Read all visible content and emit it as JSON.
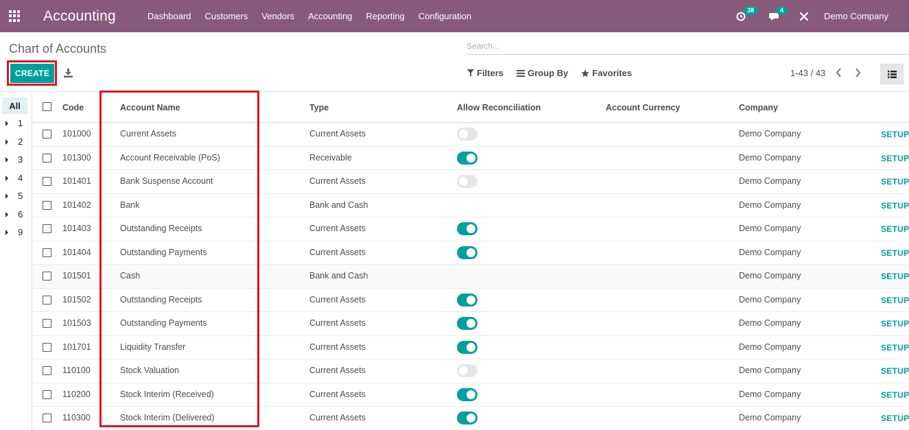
{
  "navbar": {
    "app_title": "Accounting",
    "menu": [
      "Dashboard",
      "Customers",
      "Vendors",
      "Accounting",
      "Reporting",
      "Configuration"
    ],
    "activity_count": "38",
    "message_count": "4",
    "company": "Demo Company",
    "icons": [
      "apps-grid-icon",
      "activity-clock-icon",
      "chat-bubble-icon",
      "tools-icon"
    ]
  },
  "control_panel": {
    "title": "Chart of Accounts",
    "search_placeholder": "Search...",
    "create_label": "CREATE",
    "filters_label": "Filters",
    "group_by_label": "Group By",
    "favorites_label": "Favorites",
    "pager": "1-43 / 43"
  },
  "side_panel": {
    "all_label": "All",
    "groups": [
      "1",
      "2",
      "3",
      "4",
      "5",
      "6",
      "9"
    ]
  },
  "table": {
    "columns": [
      "Code",
      "Account Name",
      "Type",
      "Allow Reconciliation",
      "Account Currency",
      "Company"
    ],
    "setup_label": "SETUP",
    "rows": [
      {
        "code": "101000",
        "name": "Current Assets",
        "type": "Current Assets",
        "reconcile": "off",
        "currency": "",
        "company": "Demo Company"
      },
      {
        "code": "101300",
        "name": "Account Receivable (PoS)",
        "type": "Receivable",
        "reconcile": "on",
        "currency": "",
        "company": "Demo Company"
      },
      {
        "code": "101401",
        "name": "Bank Suspense Account",
        "type": "Current Assets",
        "reconcile": "off",
        "currency": "",
        "company": "Demo Company"
      },
      {
        "code": "101402",
        "name": "Bank",
        "type": "Bank and Cash",
        "reconcile": "none",
        "currency": "",
        "company": "Demo Company"
      },
      {
        "code": "101403",
        "name": "Outstanding Receipts",
        "type": "Current Assets",
        "reconcile": "on",
        "currency": "",
        "company": "Demo Company"
      },
      {
        "code": "101404",
        "name": "Outstanding Payments",
        "type": "Current Assets",
        "reconcile": "on",
        "currency": "",
        "company": "Demo Company"
      },
      {
        "code": "101501",
        "name": "Cash",
        "type": "Bank and Cash",
        "reconcile": "none",
        "currency": "",
        "company": "Demo Company"
      },
      {
        "code": "101502",
        "name": "Outstanding Receipts",
        "type": "Current Assets",
        "reconcile": "on",
        "currency": "",
        "company": "Demo Company"
      },
      {
        "code": "101503",
        "name": "Outstanding Payments",
        "type": "Current Assets",
        "reconcile": "on",
        "currency": "",
        "company": "Demo Company"
      },
      {
        "code": "101701",
        "name": "Liquidity Transfer",
        "type": "Current Assets",
        "reconcile": "on",
        "currency": "",
        "company": "Demo Company"
      },
      {
        "code": "110100",
        "name": "Stock Valuation",
        "type": "Current Assets",
        "reconcile": "off",
        "currency": "",
        "company": "Demo Company"
      },
      {
        "code": "110200",
        "name": "Stock Interim (Received)",
        "type": "Current Assets",
        "reconcile": "on",
        "currency": "",
        "company": "Demo Company"
      },
      {
        "code": "110300",
        "name": "Stock Interim (Delivered)",
        "type": "Current Assets",
        "reconcile": "on",
        "currency": "",
        "company": "Demo Company"
      }
    ]
  },
  "colors": {
    "navbar": "#875a7b",
    "primary": "#00a09d",
    "highlight": "#e0141e"
  }
}
